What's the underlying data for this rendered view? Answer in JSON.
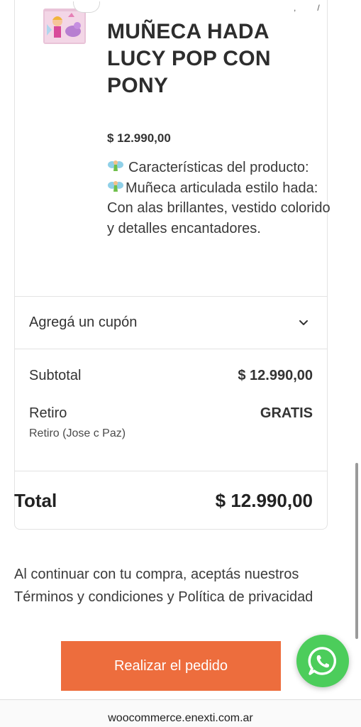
{
  "product": {
    "name": "MUÑECA HADA LUCY POP CON PONY",
    "price": "$ 12.990,00",
    "desc_line1": "Características del producto:",
    "desc_line2": "Muñeca articulada estilo hada: Con alas brillantes, vestido colorido y detalles encantadores.",
    "fairy_icon": "fairy-emoji"
  },
  "coupon": {
    "label": "Agregá un cupón",
    "icon": "chevron-down-icon"
  },
  "summary": {
    "subtotal_label": "Subtotal",
    "subtotal_value": "$ 12.990,00",
    "shipping_label": "Retiro",
    "shipping_value": "GRATIS",
    "shipping_detail": "Retiro (Jose c Paz)",
    "total_label": "Total",
    "total_value": "$ 12.990,00"
  },
  "terms": {
    "text": "Al continuar con tu compra, aceptás nuestros Términos y condiciones y Política de privacidad"
  },
  "actions": {
    "place_order": "Realizar el pedido"
  },
  "browser": {
    "url": "woocommerce.enexti.com.ar"
  },
  "colors": {
    "accent": "#ed6d3d",
    "whatsapp": "#4ccd5b"
  }
}
